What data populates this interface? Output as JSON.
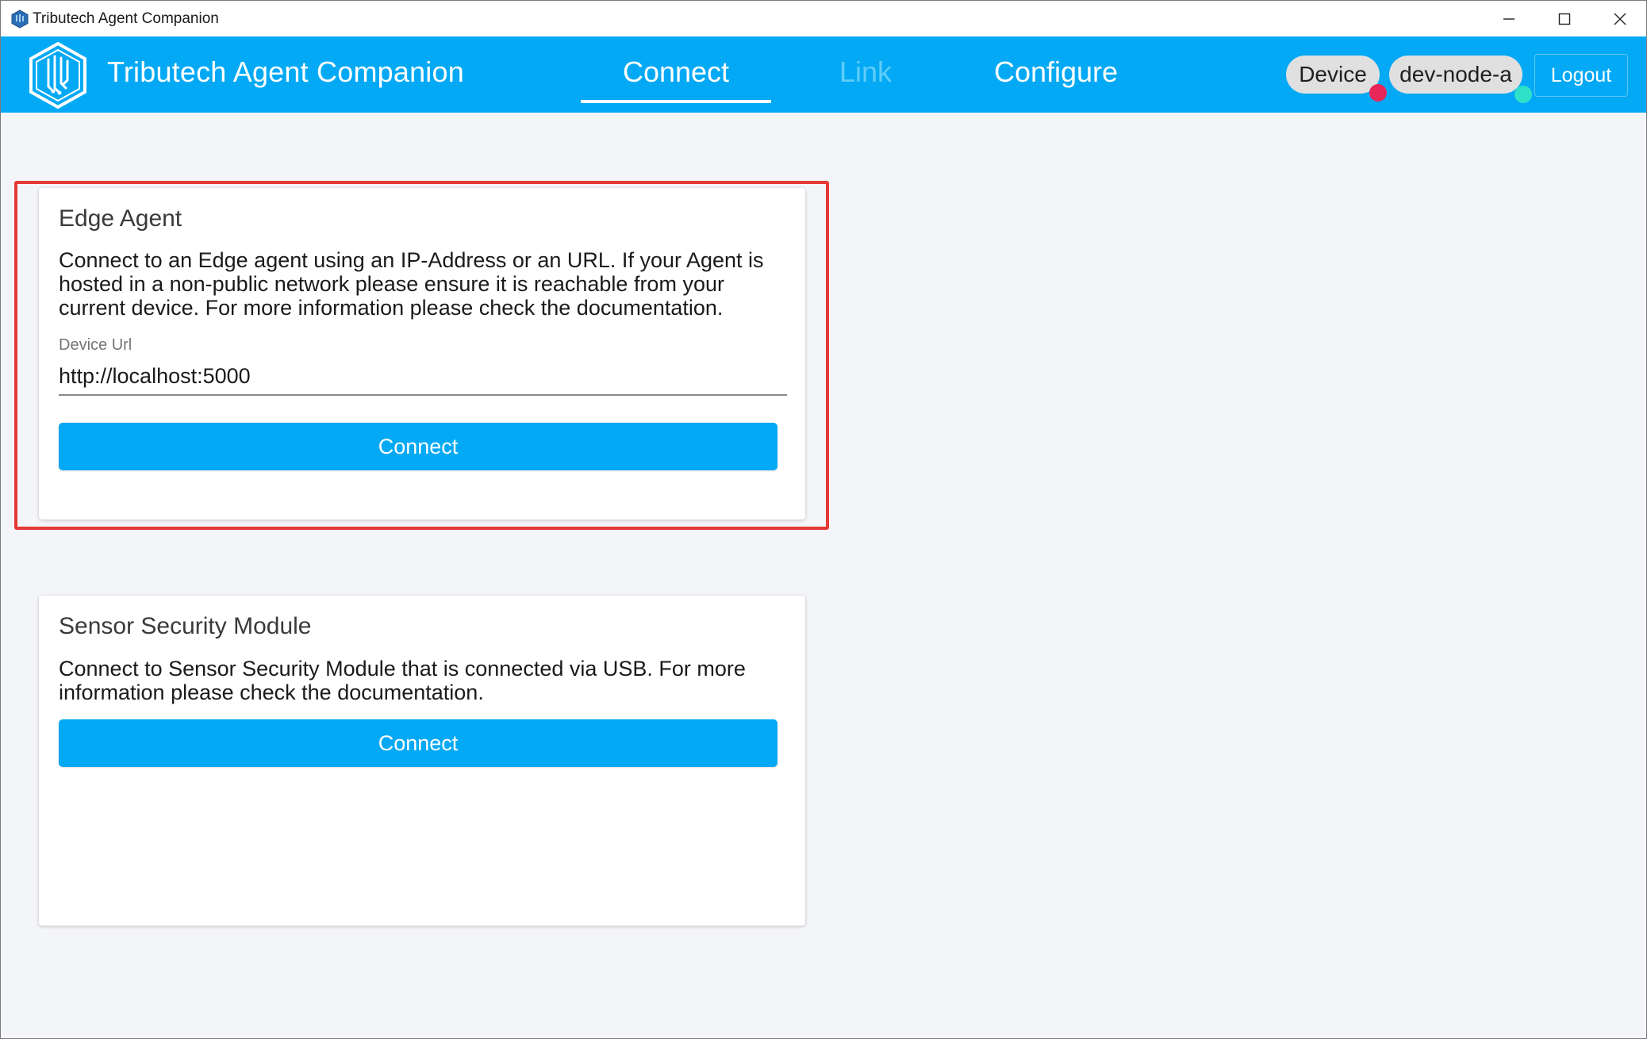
{
  "window": {
    "title": "Tributech Agent Companion",
    "controls": {
      "minimize": "minimize-icon",
      "maximize": "maximize-icon",
      "close": "close-icon"
    }
  },
  "header": {
    "brand": "Tributech Agent Companion",
    "tabs": [
      {
        "label": "Connect",
        "state": "active"
      },
      {
        "label": "Link",
        "state": "disabled"
      },
      {
        "label": "Configure",
        "state": "normal"
      }
    ],
    "chips": [
      {
        "label": "Device",
        "status_color": "#e8265a"
      },
      {
        "label": "dev-node-a",
        "status_color": "#2fe0c8"
      }
    ],
    "logout_label": "Logout",
    "accent_color": "#03a9f4"
  },
  "edge_agent": {
    "title": "Edge Agent",
    "description": "Connect to an Edge agent using an IP-Address or an URL. If your Agent is hosted in a non-public network please ensure it is reachable from your current device. For more information please check the documentation.",
    "field_label": "Device Url",
    "field_value": "http://localhost:5000",
    "button_label": "Connect",
    "highlight_color": "#e53935"
  },
  "sensor_security_module": {
    "title": "Sensor Security Module",
    "description": "Connect to Sensor Security Module that is connected via USB. For more information please check the documentation.",
    "button_label": "Connect"
  }
}
